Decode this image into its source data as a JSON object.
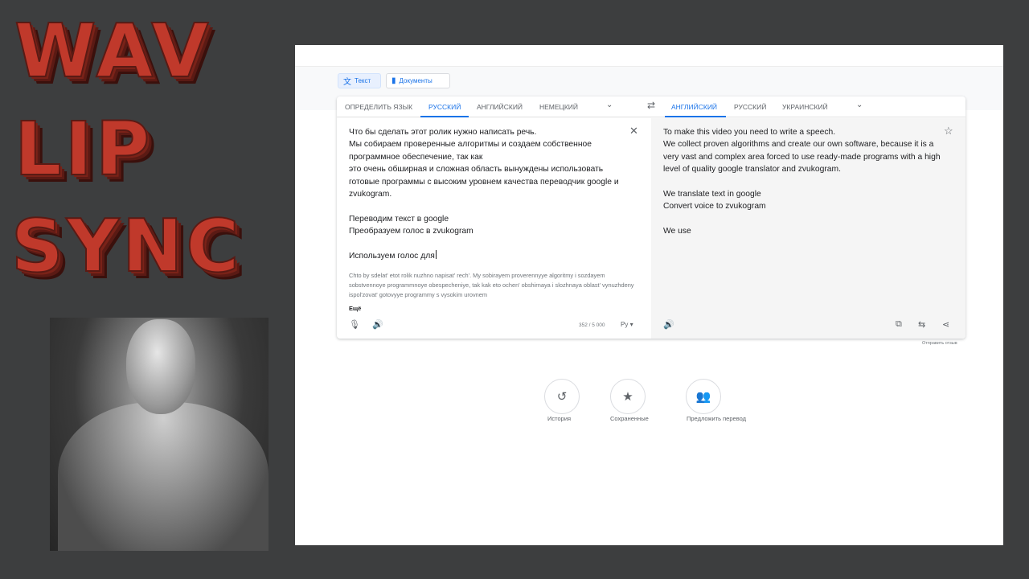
{
  "overlay": {
    "title_line1": "WAV",
    "title_line2": "LIP",
    "title_line3": "SYNC"
  },
  "colors": {
    "accent": "#1a73e8",
    "title_red": "#c0392b",
    "page_bg": "#3d3e3f"
  },
  "modes": {
    "text": "Текст",
    "documents": "Документы",
    "text_icon": "translate-icon",
    "documents_icon": "document-icon"
  },
  "source_langs": {
    "detect": "ОПРЕДЕЛИТЬ ЯЗЫК",
    "lang1": "РУССКИЙ",
    "lang2": "АНГЛИЙСКИЙ",
    "lang3": "НЕМЕЦКИЙ"
  },
  "target_langs": {
    "lang1": "АНГЛИЙСКИЙ",
    "lang2": "РУССКИЙ",
    "lang3": "УКРАИНСКИЙ"
  },
  "source": {
    "text": "Что бы сделать этот ролик нужно написать речь.\nМы собираем проверенные алгоритмы и создаем собственное программное обеспечение, так как\nэто очень обширная и сложная область вынуждены использовать готовые программы с высоким уровнем качества переводчик google и zvukogram.\n\nПереводим текст в google\nПреобразуем голос в zvukogram\n\nИспользуем голос для",
    "transliteration": "Chto by sdelat' etot rolik nuzhno napisat' rech'. My sobirayem proverennyye algoritmy i sozdayem sobstvennoye programmnoye obespecheniye, tak kak eto ochen' obshirnaya i slozhnaya oblast' vynuzhdeny ispol'zovat' gotovyye programmy s vysokim urovnem",
    "more": "Ещё",
    "char_count": "352 / 5 000",
    "keyboard": "Ру"
  },
  "target": {
    "text": "To make this video you need to write a speech.\nWe collect proven algorithms and create our own software, because it is a very vast and complex area forced to use ready-made programs with a high level of quality google translator and zvukogram.\n\nWe translate text in google\nConvert voice to zvukogram\n\nWe use"
  },
  "feedback": "Отправить отзыв",
  "bottom": {
    "history": "История",
    "saved": "Сохраненные",
    "suggest": "Предложить перевод"
  }
}
